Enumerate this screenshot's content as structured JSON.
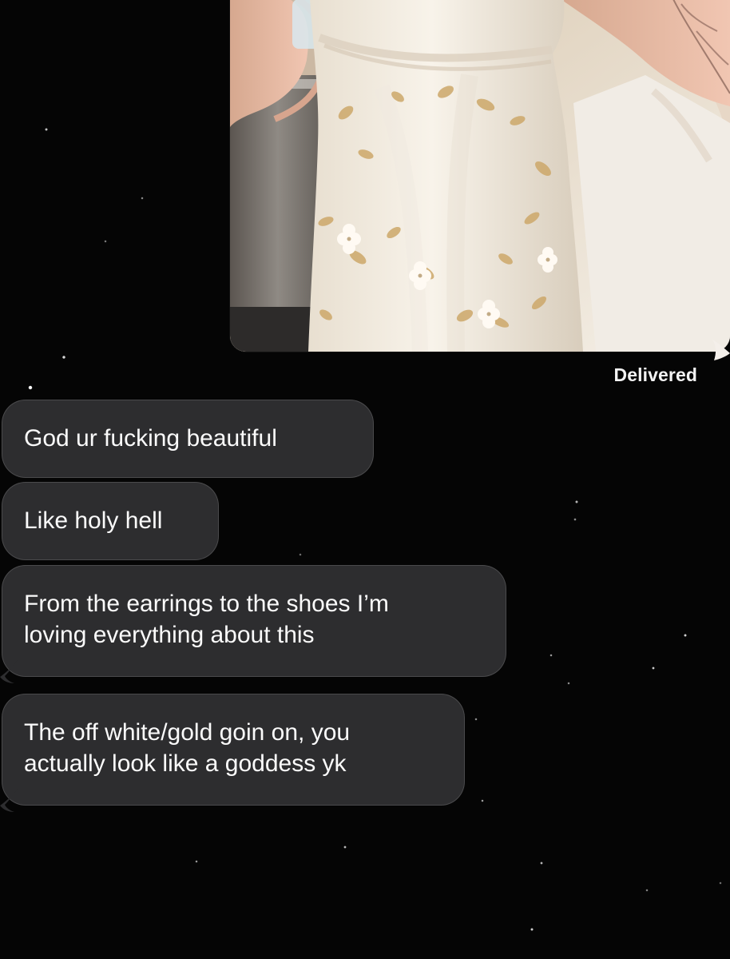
{
  "conversation": {
    "status": "Delivered",
    "attachment": {
      "type": "photo",
      "icon": "image-attachment-icon"
    },
    "incoming_messages": [
      "God ur fucking beautiful",
      "Like holy hell",
      "From the earrings to the shoes I’m\nloving everything about this",
      "The off white/gold goin on, you\nactually look like a goddess yk"
    ]
  },
  "colors": {
    "background": "#050505",
    "bubble": "#2d2d2f",
    "bubble_text": "#fbfbfb",
    "status_text": "#f3f3f3",
    "attachment_base": "#e8e1d4"
  }
}
